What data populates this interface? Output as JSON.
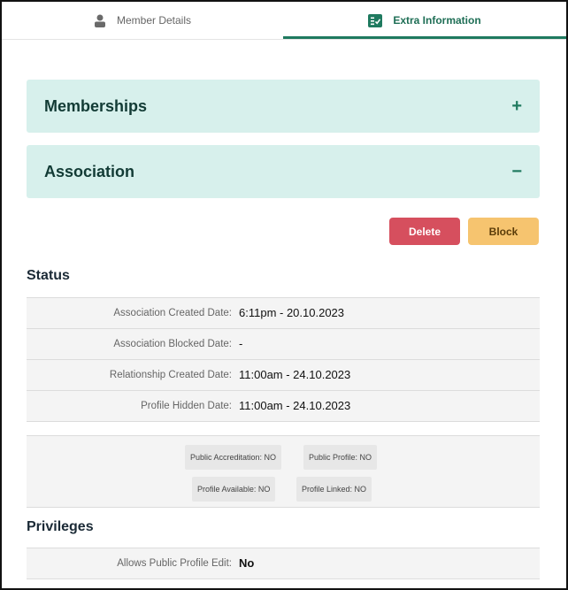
{
  "tabs": [
    {
      "label": "Member Details"
    },
    {
      "label": "Extra Information"
    }
  ],
  "accordions": {
    "memberships": {
      "title": "Memberships",
      "sign": "+"
    },
    "association": {
      "title": "Association",
      "sign": "−"
    }
  },
  "buttons": {
    "delete": "Delete",
    "block": "Block"
  },
  "status": {
    "title": "Status",
    "rows": [
      {
        "label": "Association Created Date:",
        "value": "6:11pm - 20.10.2023"
      },
      {
        "label": "Association Blocked Date:",
        "value": "-"
      },
      {
        "label": "Relationship Created Date:",
        "value": "11:00am - 24.10.2023"
      },
      {
        "label": "Profile Hidden Date:",
        "value": "11:00am - 24.10.2023"
      }
    ],
    "flags": [
      "Public Accreditation: NO",
      "Public Profile: NO",
      "Profile Available: NO",
      "Profile Linked: NO"
    ]
  },
  "privileges": {
    "title": "Privileges",
    "rows": [
      {
        "label": "Allows Public Profile Edit:",
        "value": "No"
      }
    ]
  },
  "colors": {
    "accent": "#1f7a5f",
    "accordion_bg": "#d7f0ec",
    "delete": "#d64f5e",
    "block": "#f6c46f"
  },
  "icons": {
    "member_tab": "person-icon",
    "extra_tab": "checklist-icon"
  }
}
